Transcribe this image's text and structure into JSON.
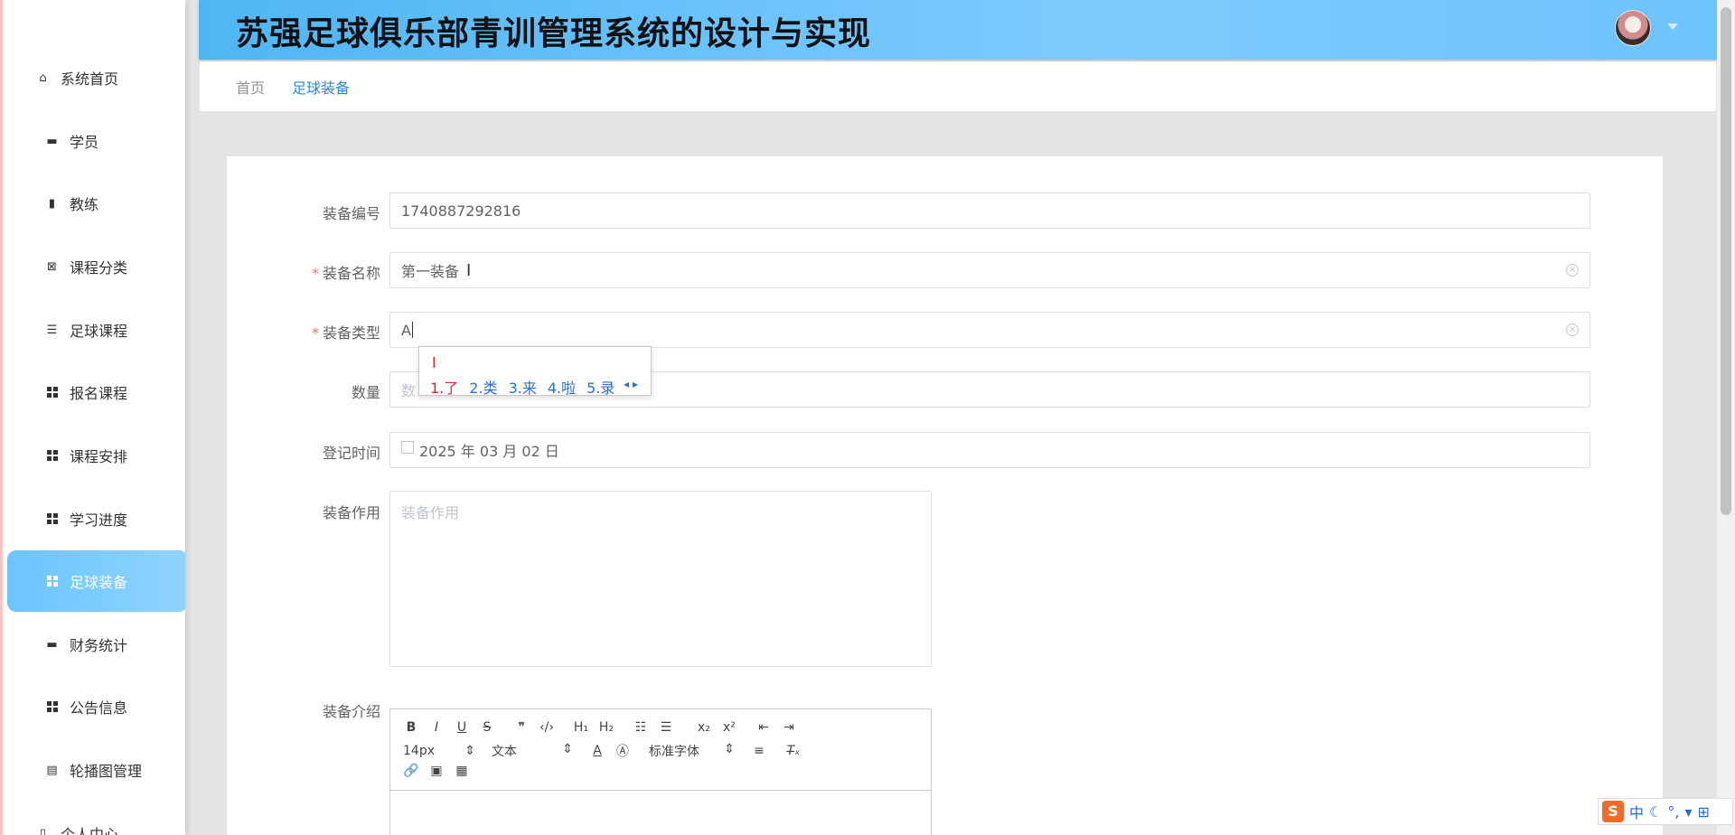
{
  "app": {
    "title": "苏强足球俱乐部青训管理系统的设计与实现"
  },
  "sidebar": {
    "items": [
      {
        "label": "系统首页",
        "icon": "home-icon"
      },
      {
        "label": "学员",
        "icon": "monitor-icon"
      },
      {
        "label": "教练",
        "icon": "book-icon"
      },
      {
        "label": "课程分类",
        "icon": "clipboard-icon"
      },
      {
        "label": "足球课程",
        "icon": "sliders-icon"
      },
      {
        "label": "报名课程",
        "icon": "grid-icon"
      },
      {
        "label": "课程安排",
        "icon": "grid-icon"
      },
      {
        "label": "学习进度",
        "icon": "grid-icon"
      },
      {
        "label": "足球装备",
        "icon": "grid-icon",
        "active": true
      },
      {
        "label": "财务统计",
        "icon": "monitor-icon"
      },
      {
        "label": "公告信息",
        "icon": "grid-icon"
      },
      {
        "label": "轮播图管理",
        "icon": "briefcase-icon"
      },
      {
        "label": "个人中心",
        "icon": "document-icon"
      }
    ],
    "active_color": "#6cc4ff"
  },
  "breadcrumb": {
    "home": "首页",
    "current": "足球装备"
  },
  "form": {
    "code": {
      "label": "装备编号",
      "value": "1740887292816"
    },
    "name": {
      "label": "装备名称",
      "value": "第一装备",
      "required": true
    },
    "type": {
      "label": "装备类型",
      "value": "A",
      "required": true
    },
    "quantity": {
      "label": "数量",
      "placeholder": "数"
    },
    "date": {
      "label": "登记时间",
      "value": "2025 年 03 月 02 日"
    },
    "purpose": {
      "label": "装备作用",
      "placeholder": "装备作用"
    },
    "intro": {
      "label": "装备介绍"
    }
  },
  "ime_popup": {
    "composition": "l",
    "candidates": [
      "1.了",
      "2.类",
      "3.来",
      "4.啦",
      "5.录"
    ]
  },
  "editor": {
    "font_size": "14px",
    "paragraph": "文本",
    "font_family": "标准字体"
  },
  "ime_bar": {
    "mode": "中"
  },
  "colors": {
    "header_gradient_start": "#4fb6f4",
    "header_gradient_end": "#7fcbff",
    "link": "#2a89d8",
    "required": "#f56c6c"
  }
}
